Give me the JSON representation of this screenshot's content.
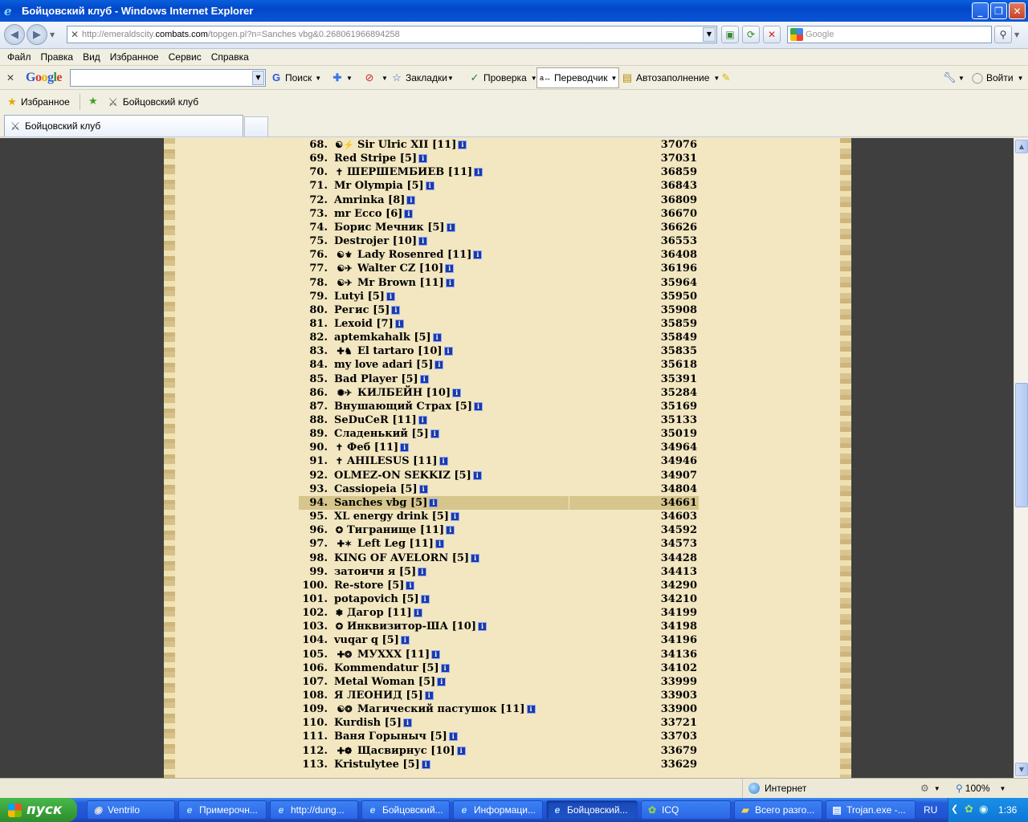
{
  "window": {
    "title": "Бойцовский клуб - Windows Internet Explorer"
  },
  "address": {
    "url_prefix": "http://emeraldscity.",
    "url_domain": "combats.com",
    "url_suffix": "/topgen.pl?n=Sanches vbg&0.268061966894258"
  },
  "search": {
    "placeholder": "Google"
  },
  "menu": [
    "Файл",
    "Правка",
    "Вид",
    "Избранное",
    "Сервис",
    "Справка"
  ],
  "google_toolbar": {
    "logo": "Google",
    "search_label": "Поиск",
    "bookmarks_label": "Закладки",
    "spellcheck_label": "Проверка",
    "translate_label": "Переводчик",
    "autofill_label": "Автозаполнение",
    "signin_label": "Войти"
  },
  "favorites_bar": {
    "favorites_label": "Избранное",
    "link_label": "Бойцовский клуб"
  },
  "tab": {
    "label": "Бойцовский клуб"
  },
  "rating": [
    {
      "rank": "68.",
      "name": "Sir Ulric XII [11]",
      "score": "37076",
      "emblem": "☯⚡"
    },
    {
      "rank": "69.",
      "name": "Red Stripe [5]",
      "score": "37031",
      "emblem": ""
    },
    {
      "rank": "70.",
      "name": "ШЕРШЕМБИЕВ [11]",
      "score": "36859",
      "emblem": "✝"
    },
    {
      "rank": "71.",
      "name": "Mr Olympia [5]",
      "score": "36843",
      "emblem": ""
    },
    {
      "rank": "72.",
      "name": "Amrinka [8]",
      "score": "36809",
      "emblem": ""
    },
    {
      "rank": "73.",
      "name": "mr Ecco [6]",
      "score": "36670",
      "emblem": ""
    },
    {
      "rank": "74.",
      "name": "Борис Мечник [5]",
      "score": "36626",
      "emblem": ""
    },
    {
      "rank": "75.",
      "name": "Destrojer [10]",
      "score": "36553",
      "emblem": ""
    },
    {
      "rank": "76.",
      "name": "Lady Rosenred [11]",
      "score": "36408",
      "emblem": "☯⚜"
    },
    {
      "rank": "77.",
      "name": "Walter CZ [10]",
      "score": "36196",
      "emblem": "☯✈"
    },
    {
      "rank": "78.",
      "name": "Mr Brown [11]",
      "score": "35964",
      "emblem": "☯✈"
    },
    {
      "rank": "79.",
      "name": "Lutyi [5]",
      "score": "35950",
      "emblem": ""
    },
    {
      "rank": "80.",
      "name": "Регис [5]",
      "score": "35908",
      "emblem": ""
    },
    {
      "rank": "81.",
      "name": "Lexoid [7]",
      "score": "35859",
      "emblem": ""
    },
    {
      "rank": "82.",
      "name": "aptemkahalk [5]",
      "score": "35849",
      "emblem": ""
    },
    {
      "rank": "83.",
      "name": "El tartaro [10]",
      "score": "35835",
      "emblem": "✚♞"
    },
    {
      "rank": "84.",
      "name": "my love adari [5]",
      "score": "35618",
      "emblem": ""
    },
    {
      "rank": "85.",
      "name": "Bad Player [5]",
      "score": "35391",
      "emblem": ""
    },
    {
      "rank": "86.",
      "name": "КИЛБЕЙН [10]",
      "score": "35284",
      "emblem": "✺✈"
    },
    {
      "rank": "87.",
      "name": "Внушающий Страх [5]",
      "score": "35169",
      "emblem": ""
    },
    {
      "rank": "88.",
      "name": "SeDuCeR [11]",
      "score": "35133",
      "emblem": ""
    },
    {
      "rank": "89.",
      "name": "Сладенький [5]",
      "score": "35019",
      "emblem": ""
    },
    {
      "rank": "90.",
      "name": "Феб [11]",
      "score": "34964",
      "emblem": "✝"
    },
    {
      "rank": "91.",
      "name": "AHILESUS [11]",
      "score": "34946",
      "emblem": "✝"
    },
    {
      "rank": "92.",
      "name": "OLMEZ-ON SEKKIZ [5]",
      "score": "34907",
      "emblem": ""
    },
    {
      "rank": "93.",
      "name": "Cassiopeia [5]",
      "score": "34804",
      "emblem": ""
    },
    {
      "rank": "94.",
      "name": "Sanches vbg [5]",
      "score": "34661",
      "emblem": "",
      "highlight": "true"
    },
    {
      "rank": "95.",
      "name": "XL energy drink [5]",
      "score": "34603",
      "emblem": ""
    },
    {
      "rank": "96.",
      "name": "Тигранище [11]",
      "score": "34592",
      "emblem": "✪"
    },
    {
      "rank": "97.",
      "name": "Left Leg [11]",
      "score": "34573",
      "emblem": "✚✶"
    },
    {
      "rank": "98.",
      "name": "KING OF AVELORN [5]",
      "score": "34428",
      "emblem": ""
    },
    {
      "rank": "99.",
      "name": "затоичи я [5]",
      "score": "34413",
      "emblem": ""
    },
    {
      "rank": "100.",
      "name": "Re-store [5]",
      "score": "34290",
      "emblem": ""
    },
    {
      "rank": "101.",
      "name": "potapovich [5]",
      "score": "34210",
      "emblem": ""
    },
    {
      "rank": "102.",
      "name": "Дагор [11]",
      "score": "34199",
      "emblem": "❃"
    },
    {
      "rank": "103.",
      "name": "Инквизитор-ША [10]",
      "score": "34198",
      "emblem": "✪"
    },
    {
      "rank": "104.",
      "name": "vuqar q [5]",
      "score": "34196",
      "emblem": ""
    },
    {
      "rank": "105.",
      "name": "МУХХХ [11]",
      "score": "34136",
      "emblem": "✚❂"
    },
    {
      "rank": "106.",
      "name": "Kommendatur [5]",
      "score": "34102",
      "emblem": ""
    },
    {
      "rank": "107.",
      "name": "Metal Woman [5]",
      "score": "33999",
      "emblem": ""
    },
    {
      "rank": "108.",
      "name": "Я ЛЕОНИД [5]",
      "score": "33903",
      "emblem": ""
    },
    {
      "rank": "109.",
      "name": "Магический пастушок [11]",
      "score": "33900",
      "emblem": "☯❂"
    },
    {
      "rank": "110.",
      "name": "Kurdish [5]",
      "score": "33721",
      "emblem": ""
    },
    {
      "rank": "111.",
      "name": "Ваня Горыныч [5]",
      "score": "33703",
      "emblem": ""
    },
    {
      "rank": "112.",
      "name": "Щасвирнус [10]",
      "score": "33679",
      "emblem": "✚❁"
    },
    {
      "rank": "113.",
      "name": "Kristulytee [5]",
      "score": "33629",
      "emblem": ""
    }
  ],
  "statusbar": {
    "zone": "Интернет",
    "zoom": "100%"
  },
  "taskbar": {
    "start_label": "пуск",
    "tasks": [
      "Ventrilo",
      "Примерочн...",
      "http://dung...",
      "Бойцовский...",
      "Информаци...",
      "Бойцовский...",
      "ICQ",
      "Всего разго...",
      "Trojan.exe -..."
    ],
    "lang": "RU",
    "clock": "1:36"
  },
  "colors": {
    "titlebar": "#0148c9",
    "parchment": "#f2e7c0",
    "highlight_row": "#d6c58c",
    "page_background": "#3f3f3f",
    "info_icon": "#1b3aa8"
  }
}
